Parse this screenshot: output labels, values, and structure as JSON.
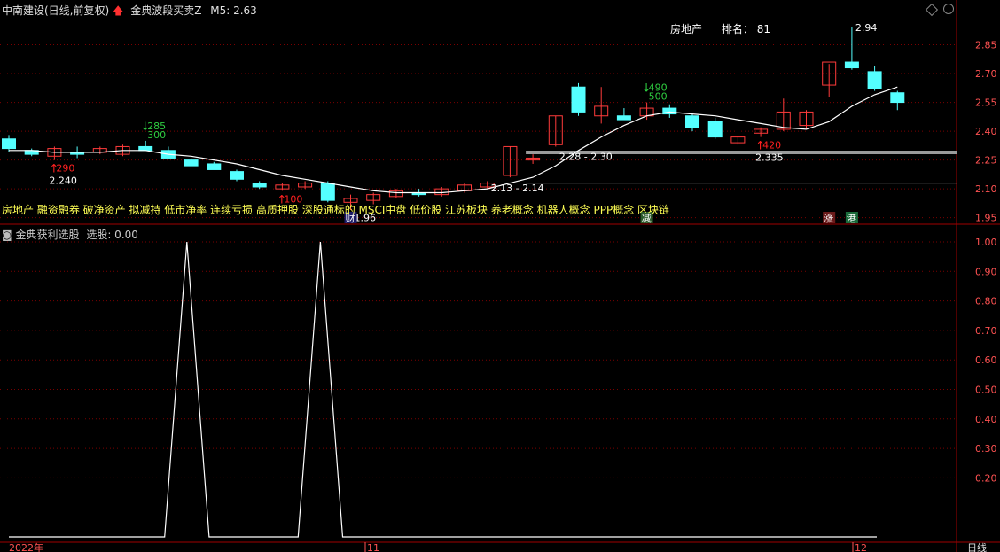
{
  "header": {
    "stock_label": "中南建设(日线,前复权)",
    "indicator_name": "金典波段买卖Z",
    "m5_label": "M5: 2.63"
  },
  "sector": {
    "name": "房地产",
    "rank_label": "排名：",
    "rank_value": "81"
  },
  "concepts_text": "房地产 融资融券 破净资产 拟减持 低市净率 连续亏损 高质押股 深股通标的 MSCI中盘 低价股 江苏板块 养老概念 机器人概念 PPP概念 区块链",
  "sub_header": {
    "indicator_name": "金典获利选股",
    "value_label": "选股: 0.00"
  },
  "x_axis": {
    "labels": [
      "2022年",
      "11",
      "12"
    ],
    "period_label": "日线"
  },
  "colors": {
    "up": "#ff3b3b",
    "down": "#54ffff",
    "ma": "#ffffff",
    "grid": "#7a0000",
    "axis_text": "#ff5252",
    "support": "#9a9a9a",
    "marker_up": "#ff2020",
    "marker_down": "#2ecc40",
    "concept": "#ffff54"
  },
  "chart_data": [
    {
      "type": "candlestick",
      "y_ticks": [
        "2.85",
        "2.70",
        "2.55",
        "2.40",
        "2.25",
        "2.10",
        "1.95"
      ],
      "y_range": [
        1.93,
        3.0
      ],
      "candles": [
        {
          "o": 2.36,
          "h": 2.38,
          "l": 2.29,
          "c": 2.31
        },
        {
          "o": 2.3,
          "h": 2.31,
          "l": 2.27,
          "c": 2.28
        },
        {
          "o": 2.27,
          "h": 2.32,
          "l": 2.25,
          "c": 2.31
        },
        {
          "o": 2.29,
          "h": 2.32,
          "l": 2.26,
          "c": 2.28
        },
        {
          "o": 2.29,
          "h": 2.32,
          "l": 2.28,
          "c": 2.31
        },
        {
          "o": 2.28,
          "h": 2.33,
          "l": 2.27,
          "c": 2.32
        },
        {
          "o": 2.32,
          "h": 2.35,
          "l": 2.3,
          "c": 2.3
        },
        {
          "o": 2.3,
          "h": 2.32,
          "l": 2.27,
          "c": 2.26
        },
        {
          "o": 2.25,
          "h": 2.26,
          "l": 2.22,
          "c": 2.22
        },
        {
          "o": 2.23,
          "h": 2.24,
          "l": 2.2,
          "c": 2.2
        },
        {
          "o": 2.19,
          "h": 2.2,
          "l": 2.14,
          "c": 2.15
        },
        {
          "o": 2.13,
          "h": 2.14,
          "l": 2.1,
          "c": 2.11
        },
        {
          "o": 2.1,
          "h": 2.13,
          "l": 2.09,
          "c": 2.12
        },
        {
          "o": 2.11,
          "h": 2.14,
          "l": 2.1,
          "c": 2.13
        },
        {
          "o": 2.13,
          "h": 2.14,
          "l": 2.03,
          "c": 2.04
        },
        {
          "o": 2.03,
          "h": 2.07,
          "l": 1.99,
          "c": 2.05
        },
        {
          "o": 2.04,
          "h": 2.08,
          "l": 2.02,
          "c": 2.07
        },
        {
          "o": 2.06,
          "h": 2.1,
          "l": 2.05,
          "c": 2.09
        },
        {
          "o": 2.08,
          "h": 2.1,
          "l": 2.06,
          "c": 2.07
        },
        {
          "o": 2.07,
          "h": 2.11,
          "l": 2.06,
          "c": 2.1
        },
        {
          "o": 2.09,
          "h": 2.13,
          "l": 2.08,
          "c": 2.12
        },
        {
          "o": 2.11,
          "h": 2.14,
          "l": 2.1,
          "c": 2.13
        },
        {
          "o": 2.17,
          "h": 2.32,
          "l": 2.16,
          "c": 2.32
        },
        {
          "o": 2.25,
          "h": 2.28,
          "l": 2.23,
          "c": 2.26
        },
        {
          "o": 2.33,
          "h": 2.48,
          "l": 2.32,
          "c": 2.48
        },
        {
          "o": 2.63,
          "h": 2.65,
          "l": 2.48,
          "c": 2.5
        },
        {
          "o": 2.48,
          "h": 2.63,
          "l": 2.44,
          "c": 2.53
        },
        {
          "o": 2.48,
          "h": 2.52,
          "l": 2.46,
          "c": 2.46
        },
        {
          "o": 2.48,
          "h": 2.55,
          "l": 2.46,
          "c": 2.52
        },
        {
          "o": 2.52,
          "h": 2.54,
          "l": 2.47,
          "c": 2.49
        },
        {
          "o": 2.48,
          "h": 2.49,
          "l": 2.4,
          "c": 2.42
        },
        {
          "o": 2.45,
          "h": 2.47,
          "l": 2.36,
          "c": 2.37
        },
        {
          "o": 2.34,
          "h": 2.37,
          "l": 2.33,
          "c": 2.37
        },
        {
          "o": 2.39,
          "h": 2.42,
          "l": 2.37,
          "c": 2.41
        },
        {
          "o": 2.41,
          "h": 2.57,
          "l": 2.4,
          "c": 2.5
        },
        {
          "o": 2.43,
          "h": 2.51,
          "l": 2.41,
          "c": 2.5
        },
        {
          "o": 2.64,
          "h": 2.75,
          "l": 2.58,
          "c": 2.76
        },
        {
          "o": 2.76,
          "h": 2.94,
          "l": 2.72,
          "c": 2.73
        },
        {
          "o": 2.71,
          "h": 2.74,
          "l": 2.61,
          "c": 2.62
        },
        {
          "o": 2.6,
          "h": 2.61,
          "l": 2.51,
          "c": 2.55
        }
      ],
      "ma5": [
        2.3,
        2.3,
        2.29,
        2.29,
        2.29,
        2.3,
        2.3,
        2.28,
        2.27,
        2.25,
        2.23,
        2.2,
        2.17,
        2.15,
        2.13,
        2.11,
        2.09,
        2.08,
        2.08,
        2.08,
        2.09,
        2.1,
        2.13,
        2.16,
        2.22,
        2.3,
        2.37,
        2.43,
        2.48,
        2.5,
        2.49,
        2.48,
        2.46,
        2.44,
        2.42,
        2.41,
        2.45,
        2.53,
        2.59,
        2.63
      ],
      "support_line": {
        "value": 2.29,
        "from_index": 23
      },
      "annotations": [
        {
          "i": 2,
          "kind": "up",
          "label": "290",
          "level": "2.240"
        },
        {
          "i": 6,
          "kind": "down",
          "label": "285",
          "sub": "300"
        },
        {
          "i": 12,
          "kind": "up",
          "label": "100"
        },
        {
          "i": 28,
          "kind": "down",
          "label": "490",
          "sub": "500"
        },
        {
          "i": 33,
          "kind": "up",
          "label": "420",
          "level": "2.335"
        }
      ],
      "price_texts": [
        {
          "i": 24,
          "text": "2.28 - 2.30",
          "y": 2.27
        },
        {
          "i": 21,
          "text": "2.13 - 2.14",
          "y": 2.105
        },
        {
          "i": 15,
          "text": "1.96",
          "y": 1.95
        },
        {
          "i": 37,
          "text": "2.94",
          "y": 2.94
        }
      ],
      "event_tags": [
        {
          "i": 15,
          "text": "财",
          "bg": "#1a1a66"
        },
        {
          "i": 28,
          "text": "减",
          "bg": "#2a5a2a"
        },
        {
          "i": 36,
          "text": "涨",
          "bg": "#6a1a1a"
        },
        {
          "i": 37,
          "text": "港",
          "bg": "#1a6a3a"
        }
      ]
    },
    {
      "type": "line",
      "name": "选股",
      "y_ticks": [
        "1.00",
        "0.90",
        "0.80",
        "0.70",
        "0.60",
        "0.50",
        "0.40",
        "0.30",
        "0.20"
      ],
      "y_range": [
        0,
        1.0
      ],
      "x": [
        0,
        1,
        2,
        3,
        4,
        5,
        6,
        7,
        8,
        9,
        10,
        11,
        12,
        13,
        14,
        15,
        16,
        17,
        18,
        19,
        20,
        21,
        22,
        23,
        24,
        25,
        26,
        27,
        28,
        29,
        30,
        31,
        32,
        33,
        34,
        35,
        36,
        37,
        38,
        39
      ],
      "values": [
        0,
        0,
        0,
        0,
        0,
        0,
        0,
        0,
        1,
        0,
        0,
        0,
        0,
        0,
        1,
        0,
        0,
        0,
        0,
        0,
        0,
        0,
        0,
        0,
        0,
        0,
        0,
        0,
        0,
        0,
        0,
        0,
        0,
        0,
        0,
        0,
        0,
        0,
        0,
        0
      ]
    }
  ]
}
